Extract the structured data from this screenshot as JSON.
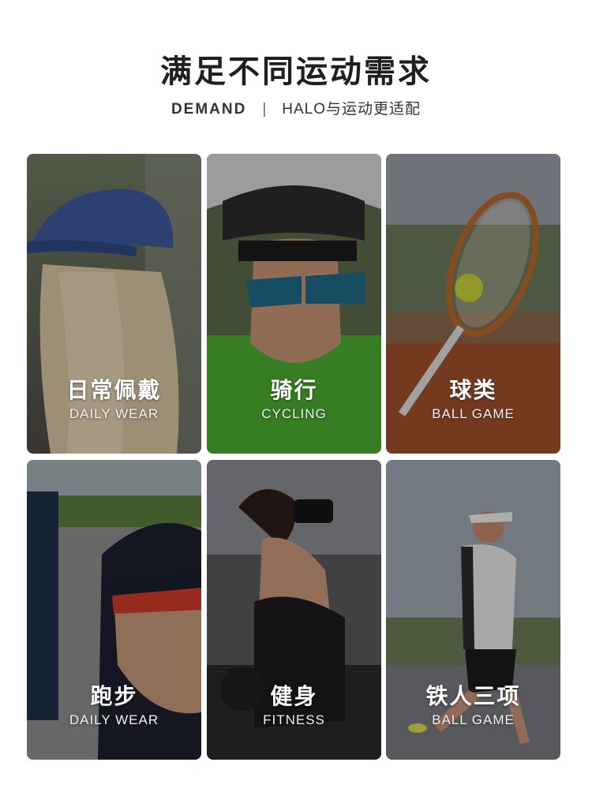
{
  "header": {
    "title": "满足不同运动需求",
    "subtitle_left": "DEMAND",
    "subtitle_sep": "|",
    "subtitle_right": "HALO与运动更适配"
  },
  "cards": [
    {
      "title_cn": "日常佩戴",
      "title_en": "DAILY WEAR"
    },
    {
      "title_cn": "骑行",
      "title_en": "CYCLING"
    },
    {
      "title_cn": "球类",
      "title_en": "BALL GAME"
    },
    {
      "title_cn": "跑步",
      "title_en": "DAILY WEAR"
    },
    {
      "title_cn": "健身",
      "title_en": "FITNESS"
    },
    {
      "title_cn": "铁人三项",
      "title_en": "BALL GAME"
    }
  ],
  "colors": {
    "background": "#ffffff",
    "title": "#1f1f1f",
    "card_text": "#ffffff"
  }
}
